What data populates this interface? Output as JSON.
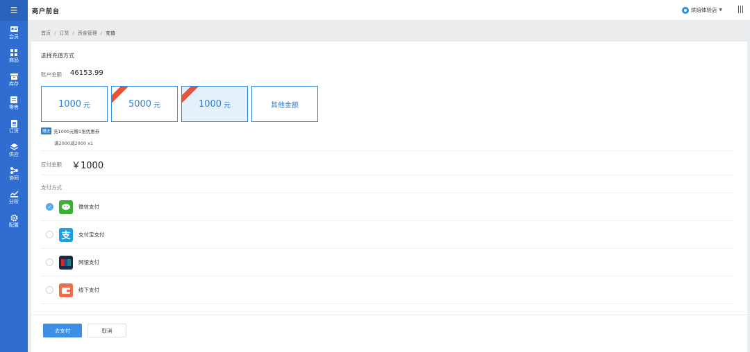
{
  "topbar": {
    "title": "商户前台",
    "store_name": "烘焙体验店"
  },
  "sidebar": {
    "items": [
      {
        "label": "会员",
        "icon": "member-card-icon"
      },
      {
        "label": "商品",
        "icon": "grid-icon"
      },
      {
        "label": "库存",
        "icon": "warehouse-icon"
      },
      {
        "label": "零售",
        "icon": "retail-icon"
      },
      {
        "label": "订货",
        "icon": "order-doc-icon"
      },
      {
        "label": "供应",
        "icon": "layers-icon"
      },
      {
        "label": "协同",
        "icon": "share-icon"
      },
      {
        "label": "分析",
        "icon": "chart-icon"
      },
      {
        "label": "配置",
        "icon": "gear-icon"
      }
    ]
  },
  "breadcrumb": [
    "首页",
    "订货",
    "资金管理",
    "充值"
  ],
  "recharge": {
    "section_title": "选择充值方式",
    "balance_label": "账户金额",
    "balance_value": "46153.99",
    "amounts": [
      {
        "value": "1000",
        "unit": "元"
      },
      {
        "value": "5000",
        "unit": "元"
      },
      {
        "value": "1000",
        "unit": "元"
      },
      {
        "value": "其他金额",
        "unit": ""
      }
    ],
    "promo_tag": "赠送",
    "promo_text": "充1000元赠1张优惠券",
    "coupon_text": "满2000减2000 x1",
    "payable_label": "应付金额",
    "payable_value": "￥1000"
  },
  "payment": {
    "title": "支付方式",
    "methods": [
      {
        "name": "微信支付",
        "icon": "wechat-pay-icon",
        "color": "#3cb034"
      },
      {
        "name": "支付宝支付",
        "icon": "alipay-icon",
        "color": "#1a9fe3"
      },
      {
        "name": "网银支付",
        "icon": "unionpay-icon",
        "color": "#1c2a4a"
      },
      {
        "name": "线下支付",
        "icon": "wallet-icon",
        "color": "#f26b4b"
      }
    ]
  },
  "actions": {
    "submit": "去支付",
    "cancel": "取消"
  },
  "colors": {
    "sidebar": "#2f6dd0",
    "accent": "#2e8de2",
    "primary_button": "#3d8ee6"
  }
}
